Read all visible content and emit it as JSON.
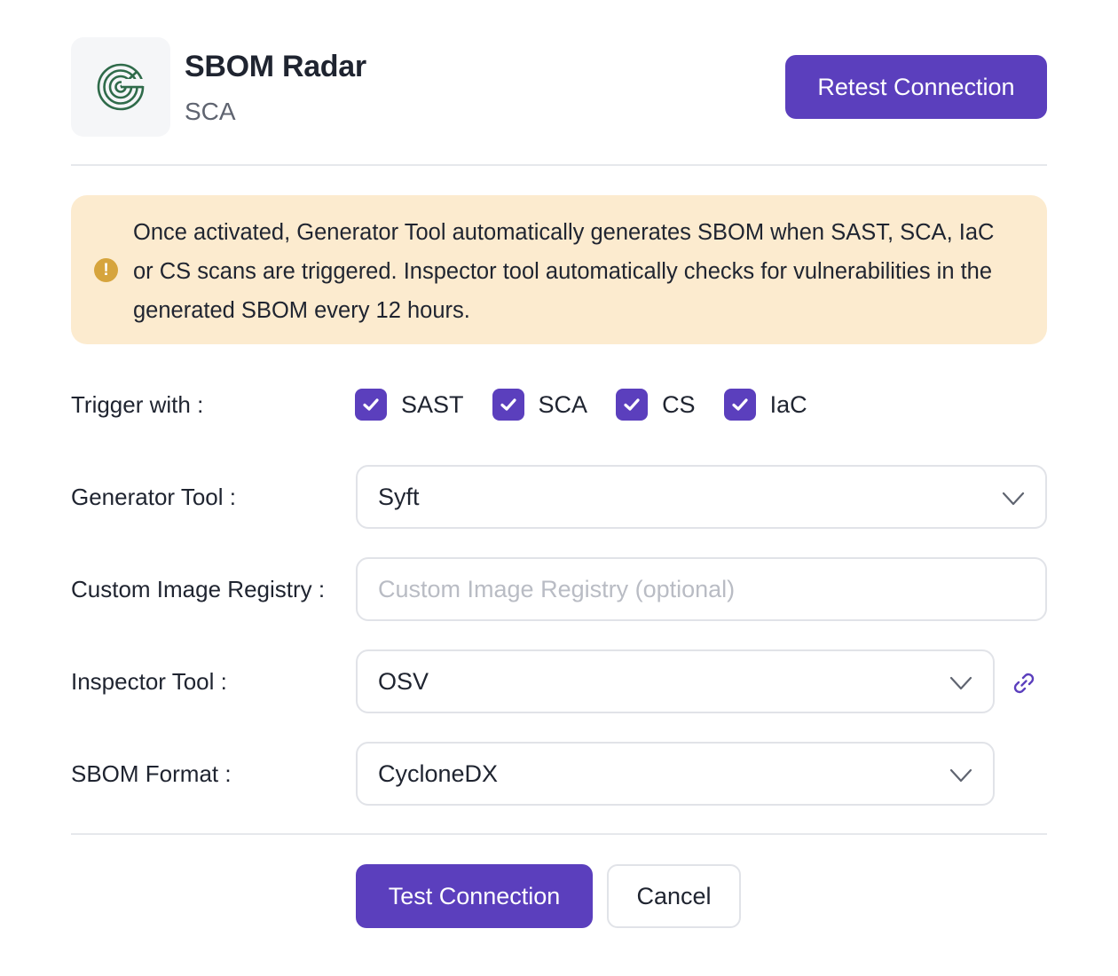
{
  "integration": {
    "name": "SBOM Radar",
    "category": "SCA",
    "logo_icon": "radar-icon",
    "retest_label": "Retest Connection"
  },
  "notice": {
    "icon": "exclamation-icon",
    "text": "Once activated, Generator Tool automatically generates SBOM when SAST, SCA, IaC or CS scans are triggered. Inspector tool automatically checks for vulnerabilities in the generated SBOM every 12 hours."
  },
  "form": {
    "trigger": {
      "label": "Trigger with :",
      "options": [
        {
          "label": "SAST",
          "checked": true
        },
        {
          "label": "SCA",
          "checked": true
        },
        {
          "label": "CS",
          "checked": true
        },
        {
          "label": "IaC",
          "checked": true
        }
      ]
    },
    "generator_tool": {
      "label": "Generator Tool :",
      "value": "Syft"
    },
    "custom_registry": {
      "label": "Custom Image Registry :",
      "value": "",
      "placeholder": "Custom Image Registry (optional)"
    },
    "inspector_tool": {
      "label": "Inspector Tool :",
      "value": "OSV",
      "link_icon": "link-icon"
    },
    "sbom_format": {
      "label": "SBOM Format :",
      "value": "CycloneDX"
    }
  },
  "actions": {
    "test_label": "Test Connection",
    "cancel_label": "Cancel"
  },
  "colors": {
    "primary": "#5b3fbd",
    "notice_bg": "#fcebcf",
    "notice_icon": "#d6a43d",
    "logo_green": "#2f6b4a"
  }
}
